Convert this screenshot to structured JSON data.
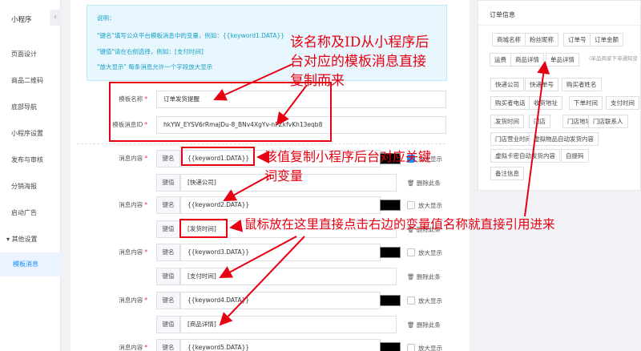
{
  "sidebar": {
    "title": "小程序",
    "collapse_glyph": "‹",
    "items": [
      "页面设计",
      "商品二维码",
      "底部导航",
      "小程序设置",
      "发布与审核",
      "分销海报",
      "启动广告"
    ],
    "group_label": "其他设置",
    "group_glyph": "▾",
    "active_item": "模板消息"
  },
  "note": {
    "lines": [
      "说明：",
      "\"键名\"填写公众平台模板消息中的变量，例如：{{keyword1.DATA}}",
      "\"键值\"请在右侧选择，例如：[支付时间]",
      "\"放大显示\" 每条消息允许一个字段放大显示"
    ]
  },
  "template": {
    "name_label": "模板名称",
    "name_value": "订单发货提醒",
    "id_label": "模板消息ID",
    "id_value": "hkYW_EYSV6rRmaJDu-8_BNv4XgYv-nPZkfvKh13eqb8"
  },
  "messages": {
    "label": "消息内容",
    "key_addon": "键名",
    "value_addon": "键值",
    "enlarge_label": "放大显示",
    "delete_label": "删除此条",
    "delete_glyph": "🗑",
    "items": [
      {
        "key": "{{keyword1.DATA}}",
        "value": "[快递公司]"
      },
      {
        "key": "{{keyword2.DATA}}",
        "value": "[发货时间]"
      },
      {
        "key": "{{keyword3.DATA}}",
        "value": "[支付时间]"
      },
      {
        "key": "{{keyword4.DATA}}",
        "value": "[商品详情]"
      },
      {
        "key": "{{keyword5.DATA}}",
        "value": ""
      }
    ]
  },
  "order_panel": {
    "title": "订单信息",
    "tags": [
      "商城名称",
      "粉丝昵称",
      "订单号",
      "订单金额",
      "运费",
      "商品详情",
      "单品详情",
      "(单品商家下单通知变量)",
      "快递公司",
      "快递单号",
      "购买者姓名",
      "购买者电话",
      "收货地址",
      "下单时间",
      "支付时间",
      "发货时间",
      "门店",
      "门店地址",
      "门店联系人",
      "门店营业时间",
      "虚拟物品自动发货内容",
      "虚拟卡密自动发货内容",
      "自提码",
      "备注信息"
    ]
  },
  "annotations": {
    "a1_line1": "该名称及ID从小程序后",
    "a1_line2": "台对应的模板消息直接",
    "a1_line3": "复制而来",
    "a2_line1": "该值复制小程序后台对应关键",
    "a2_line2": "词变量",
    "a3": "鼠标放在这里直接点击右边的变量值名称就直接引用进来"
  },
  "colors": {
    "accent": "#1890ff",
    "annotation": "#e60012",
    "note_text": "#17a2c7"
  }
}
